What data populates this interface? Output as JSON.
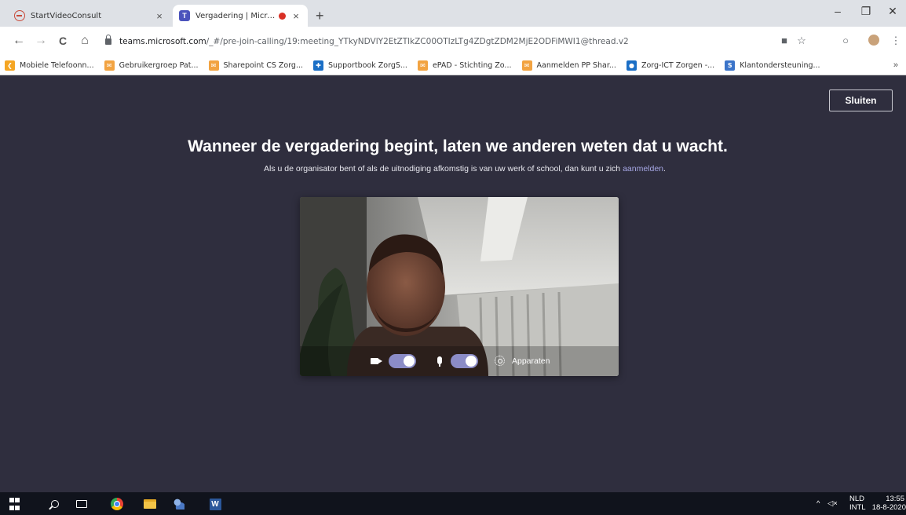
{
  "browser": {
    "tabs": [
      {
        "title": "StartVideoConsult",
        "icon": "startvideo-icon",
        "active": false
      },
      {
        "title": "Vergadering | Microsoft Teams",
        "icon": "teams-icon",
        "active": true
      }
    ],
    "new_tab": "+",
    "close_glyph": "×",
    "window_controls": {
      "minimize": "–",
      "maximize": "❐",
      "close": "✕"
    },
    "nav": {
      "back": "←",
      "forward": "→",
      "reload": "C",
      "home": "⌂"
    },
    "url": {
      "host": "teams.microsoft.com",
      "path": "/_#/pre-join-calling/19:meeting_YTkyNDVlY2EtZTlkZC00OTIzLTg4ZDgtZDM2MjE2ODFiMWI1@thread.v2"
    },
    "addr_icons": {
      "extension": "■",
      "star": "☆",
      "profile": "○",
      "menu": "⋮"
    },
    "bookmarks": [
      {
        "label": "Mobiele Telefoonn...",
        "color": "#f5a623",
        "glyph": "❮"
      },
      {
        "label": "Gebruikergroep Pat...",
        "color": "#f2a341",
        "glyph": "✉"
      },
      {
        "label": "Sharepoint CS Zorg...",
        "color": "#f2a341",
        "glyph": "✉"
      },
      {
        "label": "Supportbook ZorgS...",
        "color": "#1b6fc6",
        "glyph": "✚"
      },
      {
        "label": "ePAD - Stichting Zo...",
        "color": "#f2a341",
        "glyph": "✉"
      },
      {
        "label": "Aanmelden PP Shar...",
        "color": "#f2a341",
        "glyph": "✉"
      },
      {
        "label": "Zorg-ICT Zorgen -...",
        "color": "#1b6fc6",
        "glyph": "●"
      },
      {
        "label": "Klantondersteuning...",
        "color": "#3b74c9",
        "glyph": "S"
      }
    ],
    "bookmarks_more": "»"
  },
  "teams": {
    "close_label": "Sluiten",
    "headline": "Wanneer de vergadering begint, laten we anderen weten dat u wacht.",
    "subline_text": "Als u de organisator bent of als de uitnodiging afkomstig is van uw werk of school, dan kunt u zich ",
    "signin_link": "aanmelden",
    "subline_end": ".",
    "camera_on": true,
    "mic_on": true,
    "devices_label": "Apparaten"
  },
  "taskbar": {
    "language": "NLD",
    "layout": "INTL",
    "time": "13:55",
    "date": "18-8-2020",
    "tray_chevron": "^",
    "volume_glyph": "◁×"
  }
}
